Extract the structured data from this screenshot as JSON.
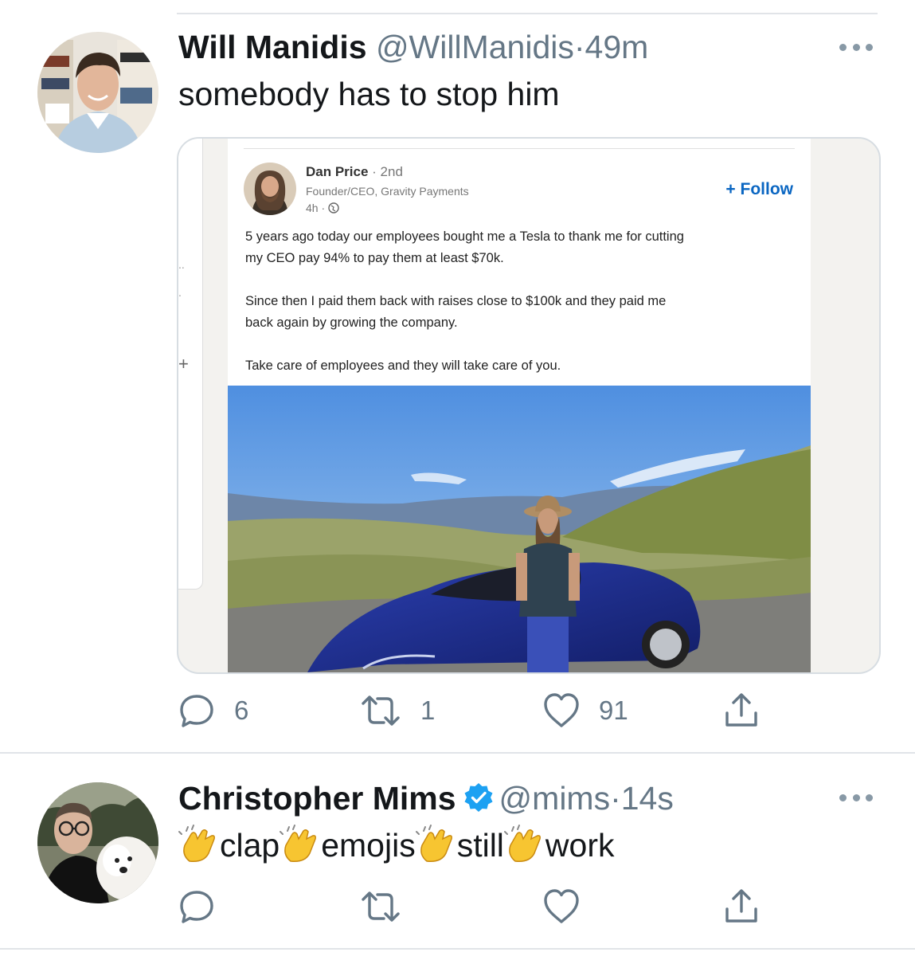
{
  "tweets": [
    {
      "name": "Will Manidis",
      "handle": "@WillManidis",
      "separator": "·",
      "time": "49m",
      "text": "somebody has to stop him",
      "replies": "6",
      "retweets": "1",
      "likes": "91"
    },
    {
      "name": "Christopher Mims",
      "handle": "@mims",
      "separator": "·",
      "time": "14s",
      "words": [
        "clap",
        "emojis",
        "still",
        "work"
      ]
    }
  ],
  "linkedin_post": {
    "author": "Dan Price",
    "degree": "· 2nd",
    "headline": "Founder/CEO, Gravity Payments",
    "time": "4h ·",
    "follow_label": "+ Follow",
    "lines": [
      "5 years ago today our employees bought me a Tesla to thank me for cutting",
      "my CEO pay 94% to pay them at least $70k.",
      "Since then I paid them back with raises close to $100k and they paid me",
      "back again by growing the company.",
      "Take care of employees and they will take care of you."
    ],
    "side_plus": "+",
    "side_dots": ".."
  },
  "colors": {
    "accent": "#1da1f2",
    "secondary_text": "#657786",
    "linkedin_blue": "#0a66c2",
    "verified": "#1da1f2"
  },
  "icons": [
    "reply-icon",
    "retweet-icon",
    "like-icon",
    "share-icon",
    "more-icon",
    "verified-badge-icon",
    "clap-emoji-icon",
    "globe-icon"
  ]
}
